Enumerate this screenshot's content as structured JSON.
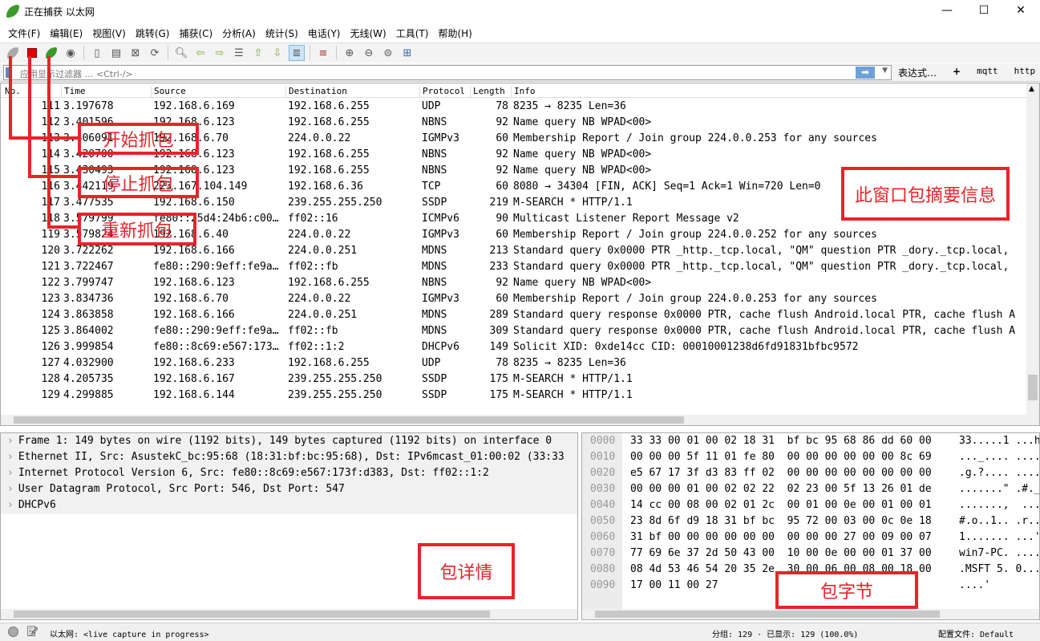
{
  "window": {
    "title": "正在捕获 以太网",
    "minimize": "—",
    "maximize": "☐",
    "close": "✕"
  },
  "menu": [
    "文件(F)",
    "编辑(E)",
    "视图(V)",
    "跳转(G)",
    "捕获(C)",
    "分析(A)",
    "统计(S)",
    "电话(Y)",
    "无线(W)",
    "工具(T)",
    "帮助(H)"
  ],
  "toolbar": {
    "icons": [
      "start-capture",
      "stop-capture",
      "restart-capture",
      "capture-options",
      "open-file",
      "save-file",
      "close-file",
      "reload-file",
      "find-packet",
      "go-back",
      "go-forward",
      "go-to-packet",
      "go-first",
      "go-last",
      "auto-scroll",
      "colorize",
      "zoom-in",
      "zoom-out",
      "zoom-normal",
      "resize-columns"
    ]
  },
  "filter": {
    "placeholder": "应用显示过滤器 … <Ctrl-/>",
    "expression": "表达式…",
    "add": "+",
    "buttons": [
      "mqtt",
      "http"
    ]
  },
  "packet_list": {
    "columns": [
      "No.",
      "Time",
      "Source",
      "Destination",
      "Protocol",
      "Length",
      "Info"
    ],
    "rows": [
      [
        "111",
        "3.197678",
        "192.168.6.169",
        "192.168.6.255",
        "UDP",
        "78",
        "8235 → 8235 Len=36"
      ],
      [
        "112",
        "3.401596",
        "192.168.6.123",
        "192.168.6.255",
        "NBNS",
        "92",
        "Name query NB WPAD<00>"
      ],
      [
        "113",
        "3.406091",
        "192.168.6.70",
        "224.0.0.22",
        "IGMPv3",
        "60",
        "Membership Report / Join group 224.0.0.253 for any sources"
      ],
      [
        "114",
        "3.420700",
        "192.168.6.123",
        "192.168.6.255",
        "NBNS",
        "92",
        "Name query NB WPAD<00>"
      ],
      [
        "115",
        "3.430493",
        "192.168.6.123",
        "192.168.6.255",
        "NBNS",
        "92",
        "Name query NB WPAD<00>"
      ],
      [
        "116",
        "3.442119",
        "223.167.104.149",
        "192.168.6.36",
        "TCP",
        "60",
        "8080 → 34304 [FIN, ACK] Seq=1 Ack=1 Win=720 Len=0"
      ],
      [
        "117",
        "3.477535",
        "192.168.6.150",
        "239.255.255.250",
        "SSDP",
        "219",
        "M-SEARCH * HTTP/1.1"
      ],
      [
        "118",
        "3.579799",
        "fe80::25d4:24b6:c00…",
        "ff02::16",
        "ICMPv6",
        "90",
        "Multicast Listener Report Message v2"
      ],
      [
        "119",
        "3.579824",
        "192.168.6.40",
        "224.0.0.22",
        "IGMPv3",
        "60",
        "Membership Report / Join group 224.0.0.252 for any sources"
      ],
      [
        "120",
        "3.722262",
        "192.168.6.166",
        "224.0.0.251",
        "MDNS",
        "213",
        "Standard query 0x0000 PTR _http._tcp.local, \"QM\" question PTR _dory._tcp.local,"
      ],
      [
        "121",
        "3.722467",
        "fe80::290:9eff:fe9a…",
        "ff02::fb",
        "MDNS",
        "233",
        "Standard query 0x0000 PTR _http._tcp.local, \"QM\" question PTR _dory._tcp.local,"
      ],
      [
        "122",
        "3.799747",
        "192.168.6.123",
        "192.168.6.255",
        "NBNS",
        "92",
        "Name query NB WPAD<00>"
      ],
      [
        "123",
        "3.834736",
        "192.168.6.70",
        "224.0.0.22",
        "IGMPv3",
        "60",
        "Membership Report / Join group 224.0.0.253 for any sources"
      ],
      [
        "124",
        "3.863858",
        "192.168.6.166",
        "224.0.0.251",
        "MDNS",
        "289",
        "Standard query response 0x0000 PTR, cache flush Android.local PTR, cache flush A"
      ],
      [
        "125",
        "3.864002",
        "fe80::290:9eff:fe9a…",
        "ff02::fb",
        "MDNS",
        "309",
        "Standard query response 0x0000 PTR, cache flush Android.local PTR, cache flush A"
      ],
      [
        "126",
        "3.999854",
        "fe80::8c69:e567:173…",
        "ff02::1:2",
        "DHCPv6",
        "149",
        "Solicit XID: 0xde14cc CID: 00010001238d6fd91831bfbc9572"
      ],
      [
        "127",
        "4.032900",
        "192.168.6.233",
        "192.168.6.255",
        "UDP",
        "78",
        "8235 → 8235 Len=36"
      ],
      [
        "128",
        "4.205735",
        "192.168.6.167",
        "239.255.255.250",
        "SSDP",
        "175",
        "M-SEARCH * HTTP/1.1"
      ],
      [
        "129",
        "4.299885",
        "192.168.6.144",
        "239.255.255.250",
        "SSDP",
        "175",
        "M-SEARCH * HTTP/1.1"
      ]
    ]
  },
  "detail": [
    "Frame 1: 149 bytes on wire (1192 bits), 149 bytes captured (1192 bits) on interface 0",
    "Ethernet II, Src: AsustekC_bc:95:68 (18:31:bf:bc:95:68), Dst: IPv6mcast_01:00:02 (33:33",
    "Internet Protocol Version 6, Src: fe80::8c69:e567:173f:d383, Dst: ff02::1:2",
    "User Datagram Protocol, Src Port: 546, Dst Port: 547",
    "DHCPv6"
  ],
  "bytes": [
    [
      "0000",
      "33 33 00 01 00 02 18 31  bf bc 95 68 86 dd 60 00",
      "33.....1 ...h"
    ],
    [
      "0010",
      "00 00 00 5f 11 01 fe 80  00 00 00 00 00 00 8c 69",
      "..._.... ...."
    ],
    [
      "0020",
      "e5 67 17 3f d3 83 ff 02  00 00 00 00 00 00 00 00",
      ".g.?.... ...."
    ],
    [
      "0030",
      "00 00 00 01 00 02 02 22  02 23 00 5f 13 26 01 de",
      ".......\" .#._"
    ],
    [
      "0040",
      "14 cc 00 08 00 02 01 2c  00 01 00 0e 00 01 00 01",
      ".......,  ...."
    ],
    [
      "0050",
      "23 8d 6f d9 18 31 bf bc  95 72 00 03 00 0c 0e 18",
      "#.o..1.. .r.."
    ],
    [
      "0060",
      "31 bf 00 00 00 00 00 00  00 00 00 27 00 09 00 07",
      "1....... ...'"
    ],
    [
      "0070",
      "77 69 6e 37 2d 50 43 00  10 00 0e 00 00 01 37 00",
      "win7-PC. ...."
    ],
    [
      "0080",
      "08 4d 53 46 54 20 35 2e  30 00 06 00 08 00 18 00",
      ".MSFT 5. 0..."
    ],
    [
      "0090",
      "17 00 11 00 27",
      "....'"
    ]
  ],
  "status": {
    "interface": "以太网: <live capture in progress>",
    "packets": "分组: 129 · 已显示: 129 (100.0%)",
    "profile": "配置文件: Default"
  },
  "annotations": {
    "start": "开始抓包",
    "stop": "停止抓包",
    "restart": "重新抓包",
    "summary": "此窗口包摘要信息",
    "detail": "包详情",
    "bytes": "包字节"
  },
  "colors": {
    "annotation": "#e8232a",
    "stop_button": "#e00000",
    "accent": "#6fa0d8"
  }
}
